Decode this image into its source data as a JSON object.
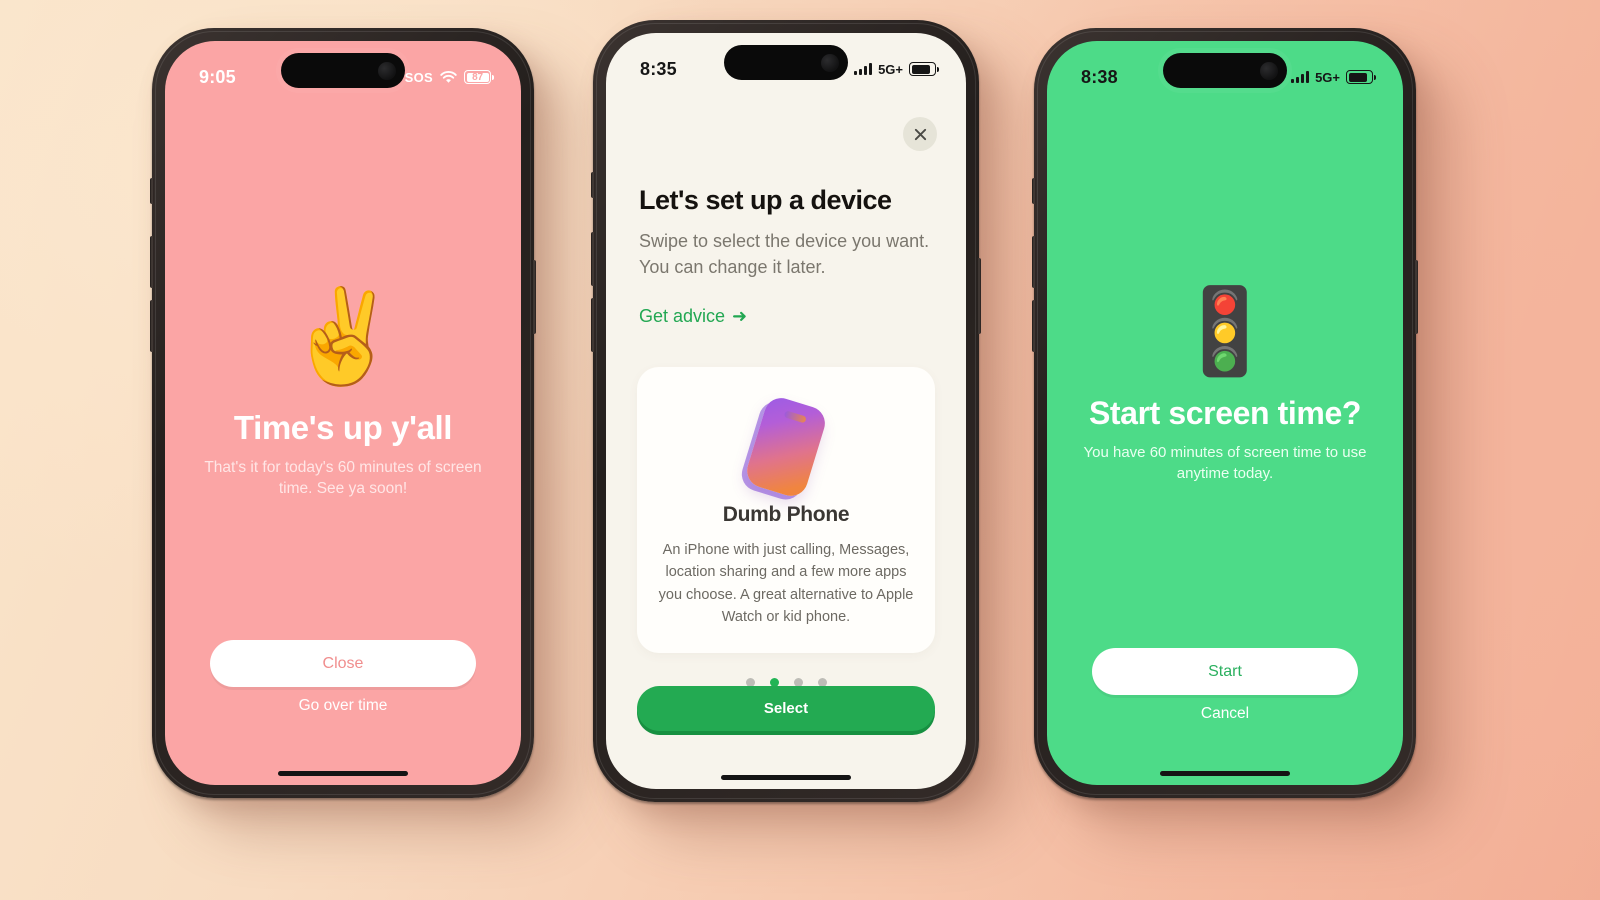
{
  "screens": [
    {
      "id": "times-up",
      "background_color": "#fba5a5",
      "status_bar": {
        "time": "9:05",
        "sos": "SOS",
        "battery_percent": "87"
      },
      "emoji": "✌️",
      "emoji_name": "victory-hand-emoji",
      "title": "Time's up y'all",
      "subtitle": "That's it for today's 60 minutes of screen time. See ya soon!",
      "primary_button": "Close",
      "secondary_link": "Go over time"
    },
    {
      "id": "set-up-device",
      "background_color": "#f7f4ec",
      "status_bar": {
        "time": "8:35",
        "network": "5G+"
      },
      "close_label": "×",
      "title": "Let's set up a device",
      "subtitle": "Swipe to select the device you want. You can change it later.",
      "advice_link": "Get advice",
      "advice_arrow": "➜",
      "card": {
        "name": "Dumb Phone",
        "description": "An iPhone with just calling, Messages, location sharing and a few more apps you choose. A great alternative to Apple Watch or kid phone."
      },
      "pagination": {
        "total": 4,
        "active_index": 1
      },
      "cta_button": "Select"
    },
    {
      "id": "start-screen-time",
      "background_color": "#4ddb88",
      "status_bar": {
        "time": "8:38",
        "network": "5G+"
      },
      "emoji": "🚦",
      "emoji_name": "traffic-light-emoji",
      "title": "Start screen time?",
      "subtitle": "You have 60 minutes of screen time to use anytime today.",
      "primary_button": "Start",
      "secondary_link": "Cancel"
    }
  ],
  "theme": {
    "accent_green": "#23aa52",
    "pink": "#fba5a5",
    "cream": "#f7f4ec",
    "mint": "#4ddb88"
  }
}
